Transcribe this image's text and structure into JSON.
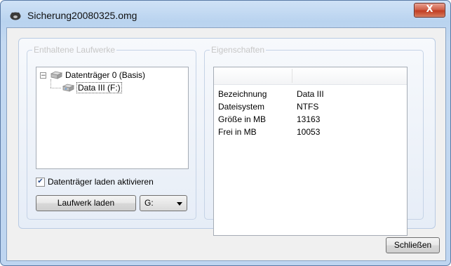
{
  "window": {
    "title": "Sicherung20080325.omg",
    "close_label": "X"
  },
  "drives_group": {
    "legend": "Enthaltene Laufwerke",
    "tree": [
      {
        "label": "Datenträger 0 (Basis)",
        "expander": "−"
      },
      {
        "label": "Data III (F:)"
      }
    ],
    "checkbox_label": "Datenträger laden aktivieren",
    "checkbox_checked": true,
    "load_button": "Laufwerk laden",
    "drive_letter": "G:"
  },
  "properties_group": {
    "legend": "Eigenschaften",
    "rows": [
      {
        "key": "Bezeichnung",
        "value": "Data III"
      },
      {
        "key": "Dateisystem",
        "value": "NTFS"
      },
      {
        "key": "Größe in MB",
        "value": "13163"
      },
      {
        "key": "Frei in MB",
        "value": "10053"
      }
    ]
  },
  "footer": {
    "close_button": "Schließen"
  }
}
